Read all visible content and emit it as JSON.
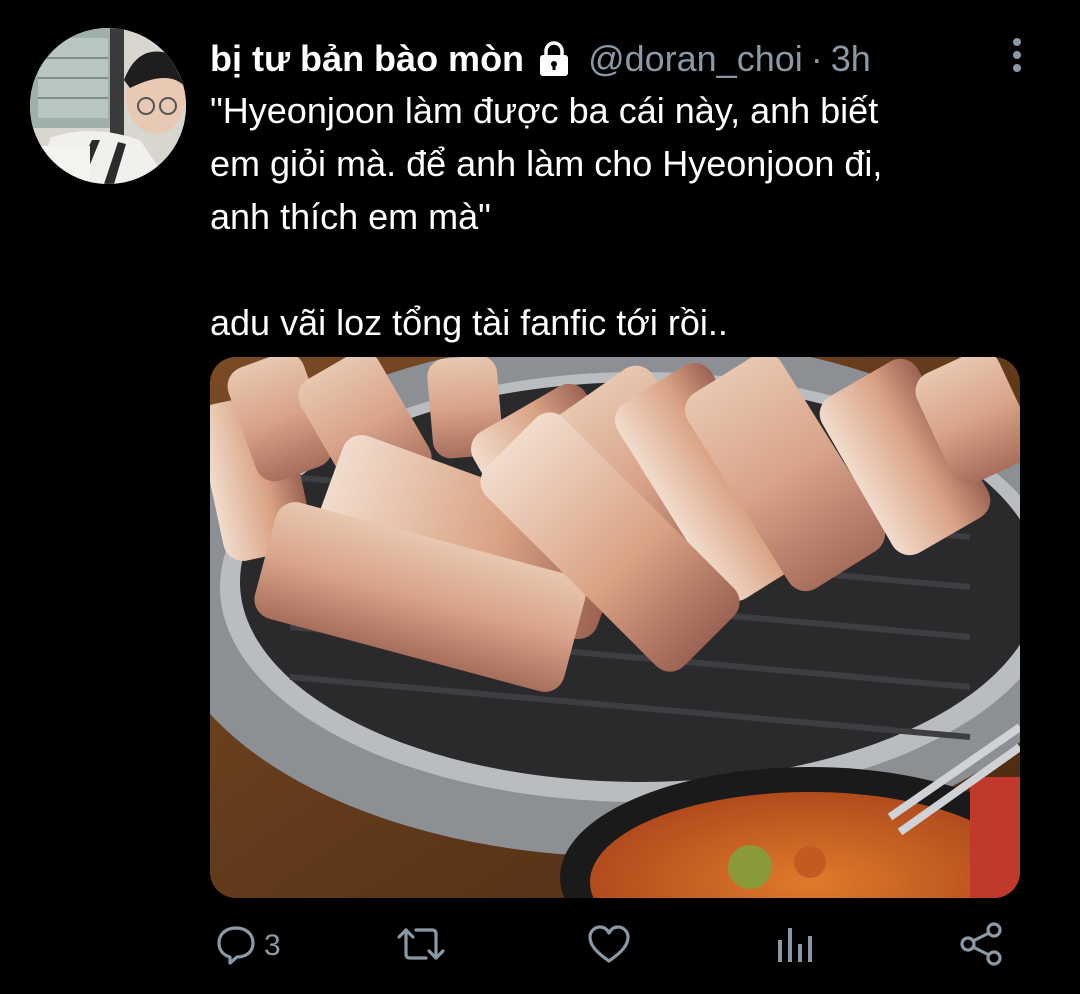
{
  "tweet": {
    "display_name": "bị tư bản bào mòn",
    "handle": "@doran_choi",
    "separator": "·",
    "time": "3h",
    "text_lines": [
      "\"Hyeonjoon làm được ba cái này, anh biết",
      "em giỏi mà. để anh làm cho Hyeonjoon đi,",
      "anh thích em mà\""
    ],
    "text_line_2": "adu vãi loz tổng tài fanfic tới rồi..",
    "icons": {
      "lock": "lock-icon",
      "more": "more-vertical-icon"
    }
  },
  "actions": {
    "reply_count": "3",
    "icons": [
      "reply-icon",
      "retweet-icon",
      "like-icon",
      "analytics-icon",
      "share-icon"
    ]
  },
  "colors": {
    "background": "#000000",
    "text": "#ffffff",
    "secondary": "#8b98a5"
  }
}
